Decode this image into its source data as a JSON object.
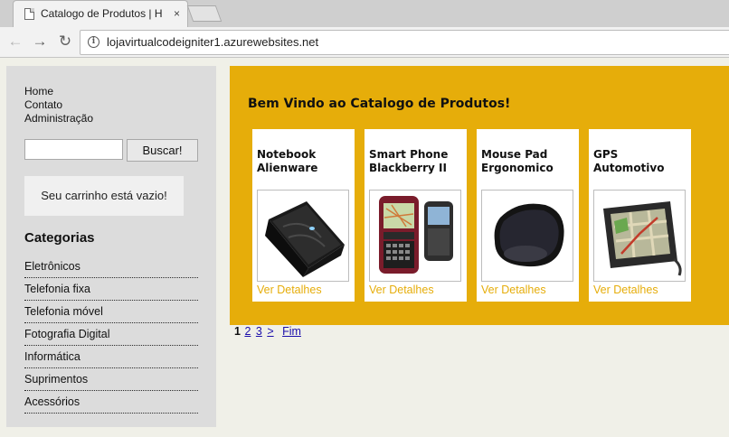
{
  "browser": {
    "tab_title": "Catalogo de Produtos | H",
    "tab_close": "×",
    "back_icon": "←",
    "forward_icon": "→",
    "reload_icon": "↻",
    "info_icon": "i",
    "url": "lojavirtualcodeigniter1.azurewebsites.net"
  },
  "sidebar": {
    "nav": [
      "Home",
      "Contato",
      "Administração"
    ],
    "search_value": "",
    "search_button": "Buscar!",
    "cart_text": "Seu carrinho está vazio!",
    "categories_title": "Categorias",
    "categories": [
      "Eletrônicos",
      "Telefonia fixa",
      "Telefonia móvel",
      "Fotografia Digital",
      "Informática",
      "Suprimentos",
      "Acessórios"
    ]
  },
  "main": {
    "welcome": "Bem Vindo ao Catalogo de Produtos!",
    "accent_color": "#e6ad0a",
    "products": [
      {
        "name": "Notebook Alienware",
        "link": "Ver Detalhes",
        "image": "laptop-image"
      },
      {
        "name": "Smart Phone Blackberry II",
        "link": "Ver Detalhes",
        "image": "phones-image"
      },
      {
        "name": "Mouse Pad Ergonomico",
        "link": "Ver Detalhes",
        "image": "mousepad-image"
      },
      {
        "name": "GPS Automotivo",
        "link": "Ver Detalhes",
        "image": "gps-image"
      }
    ]
  },
  "pagination": {
    "current": "1",
    "pages": [
      "2",
      "3"
    ],
    "next": ">",
    "last": "Fim"
  }
}
